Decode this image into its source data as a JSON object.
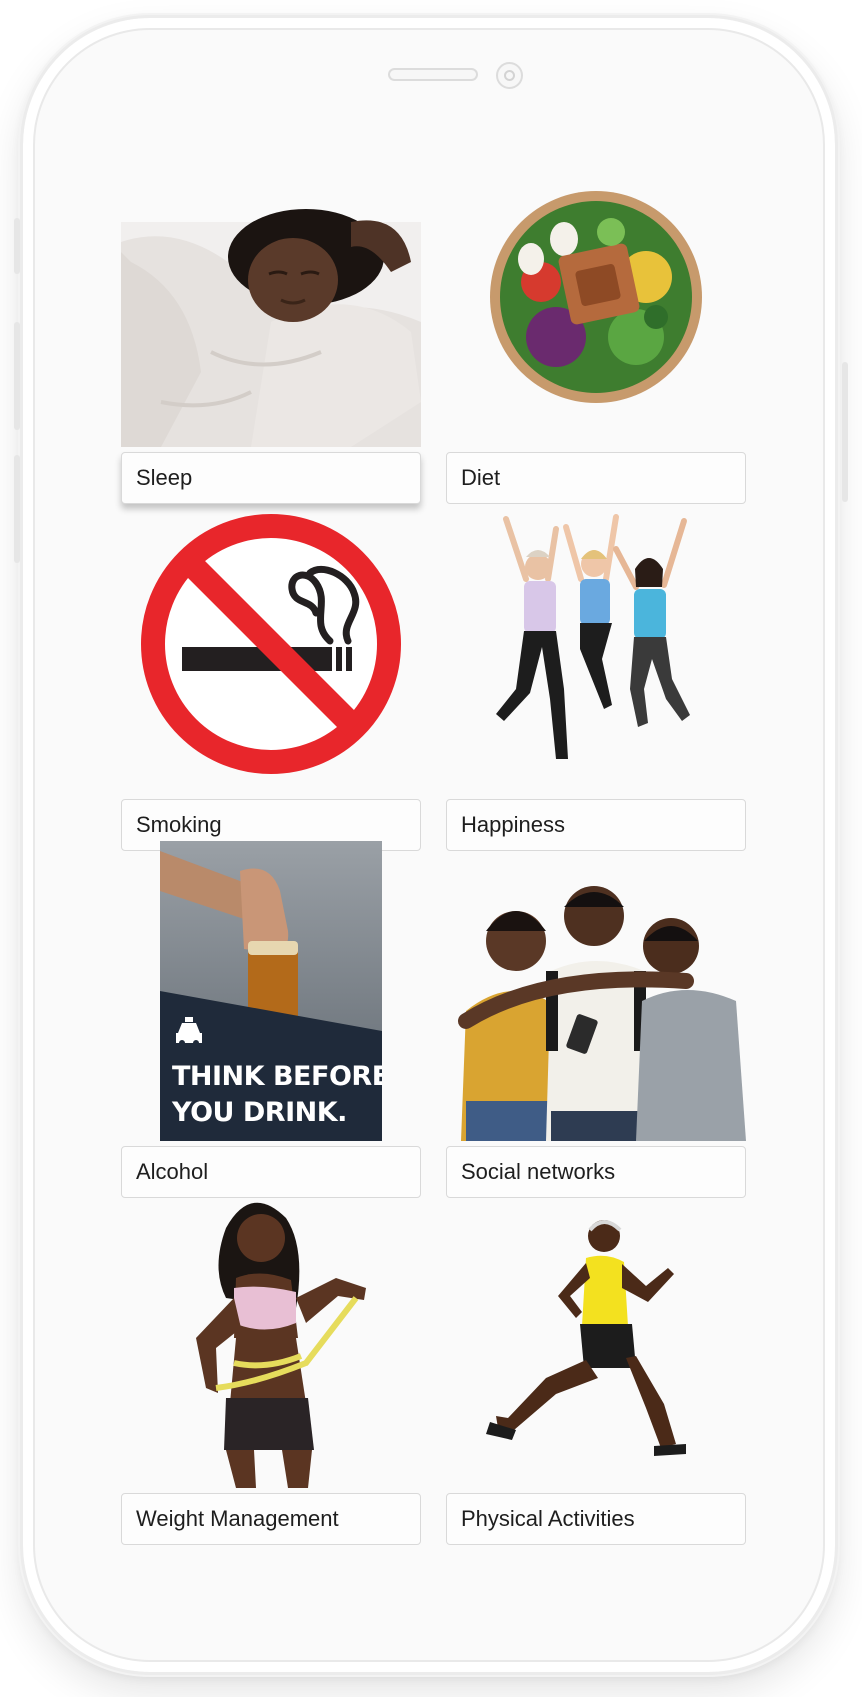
{
  "topics": [
    {
      "key": "sleep",
      "label": "Sleep"
    },
    {
      "key": "diet",
      "label": "Diet"
    },
    {
      "key": "smoking",
      "label": "Smoking"
    },
    {
      "key": "happiness",
      "label": "Happiness"
    },
    {
      "key": "alcohol",
      "label": "Alcohol"
    },
    {
      "key": "social",
      "label": "Social networks"
    },
    {
      "key": "weight",
      "label": "Weight Management"
    },
    {
      "key": "physical",
      "label": "Physical Activities"
    }
  ],
  "alcohol_poster": {
    "line1": "THINK BEFORE",
    "line2": "YOU DRINK."
  },
  "colors": {
    "no_sign_red": "#e8262b",
    "poster_navy": "#1f2a3a",
    "card_border": "#d9d9d9",
    "text": "#1e1e1e"
  },
  "icons": {
    "smoking": "no-smoking-icon",
    "alcohol_poster_taxi": "taxi-icon"
  }
}
